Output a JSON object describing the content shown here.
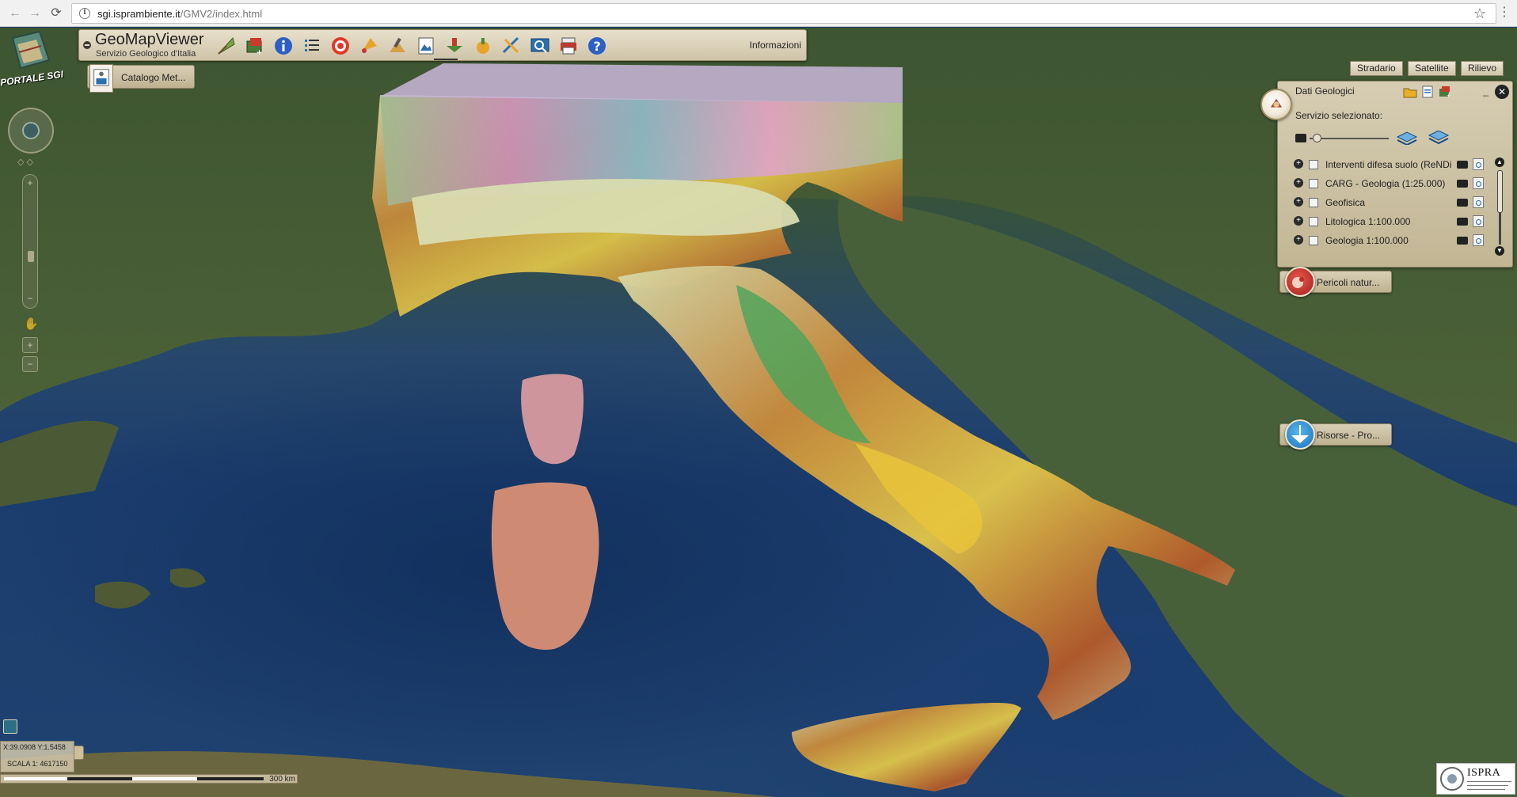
{
  "browser": {
    "back": "←",
    "forward": "→",
    "reload": "⟳",
    "info": "i",
    "url_host": "sgi.isprambiente.it",
    "url_path": "/GMV2/index.html",
    "star": "☆",
    "menu": "⋮"
  },
  "app": {
    "portal_label": "PORTALE SGI",
    "title": "GeoMapViewer",
    "subtitle": "Servizio Geologico d'Italia",
    "info_link": "Informazioni",
    "toolbar_icons": [
      "kite-icon",
      "layers-tool-icon",
      "info-icon",
      "list-icon",
      "target-icon",
      "pin-tool-icon",
      "rock-hammer-icon",
      "map-frame-icon",
      "download-icon",
      "hand-tool-icon",
      "ruler-icon",
      "map-search-icon",
      "print-icon",
      "help-icon"
    ]
  },
  "catalog": {
    "label": "Catalogo Met..."
  },
  "nav": {
    "tilt": "◇ ◇",
    "zoom_in": "+",
    "zoom_out": "−",
    "zoom_in_small": "+",
    "zoom_out_small": "−",
    "pan": "✋"
  },
  "basemaps": [
    {
      "label": "Stradario"
    },
    {
      "label": "Satellite"
    },
    {
      "label": "Rilievo"
    }
  ],
  "geodata_panel": {
    "title": "Dati Geologici",
    "minimize": "_",
    "close": "✕",
    "selected_service_label": "Servizio selezionato:",
    "scroll_up": "▲",
    "scroll_down": "▼",
    "expand_glyph": "+",
    "layers": [
      {
        "label": "Interventi difesa suolo (ReNDiS)"
      },
      {
        "label": "CARG - Geologia (1:25.000)"
      },
      {
        "label": "Geofisica"
      },
      {
        "label": "Litologica 1:100.000"
      },
      {
        "label": "Geologia 1:100.000"
      }
    ]
  },
  "side_tabs": {
    "hazards": {
      "label": "Pericoli natur..."
    },
    "resources": {
      "label": "Risorse - Pro..."
    }
  },
  "status": {
    "coords": "X:39.0908   Y:1.5458",
    "scale": "SCALA 1: 4617150",
    "scalebar_label": "300 km"
  },
  "footer": {
    "ispra_logo": "ISPRA"
  },
  "colors": {
    "panel_bg": "#d6cdb3",
    "hazard_red": "#c0282a",
    "resource_blue": "#2a8fd0"
  }
}
